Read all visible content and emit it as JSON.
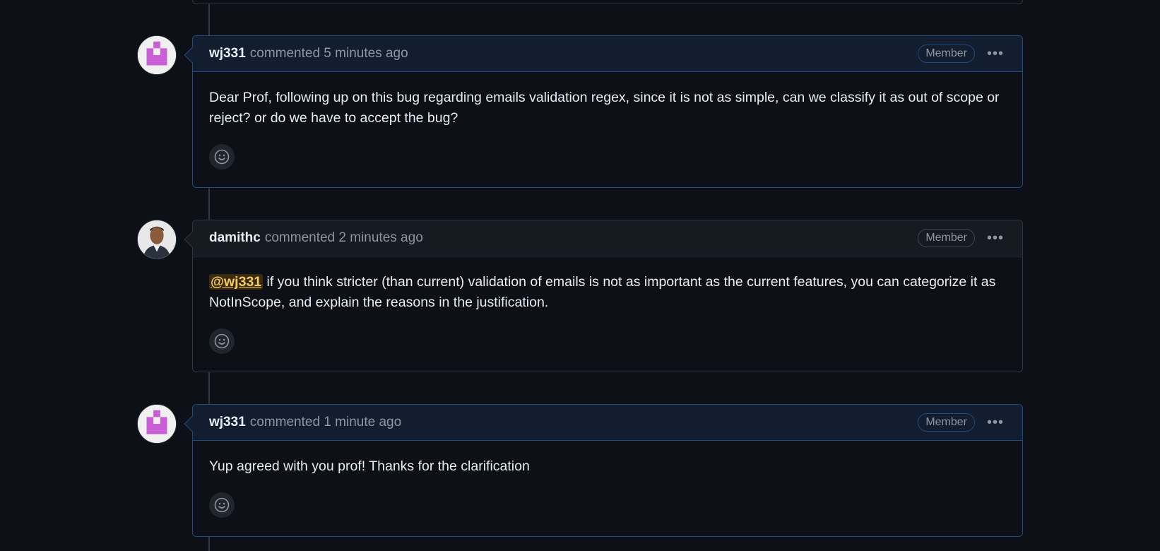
{
  "comments": [
    {
      "author": "wj331",
      "meta": "commented 5 minutes ago",
      "badge": "Member",
      "body": "Dear Prof, following up on this bug regarding emails validation regex, since it is not as simple, can we classify it as out of scope or reject? or do we have to accept the bug?"
    },
    {
      "author": "damithc",
      "meta": "commented 2 minutes ago",
      "badge": "Member",
      "mention": "@wj331",
      "body": " if you think stricter (than current) validation of emails is not as important as the current features, you can categorize it as NotInScope, and explain the reasons in the justification."
    },
    {
      "author": "wj331",
      "meta": "commented 1 minute ago",
      "badge": "Member",
      "body": "Yup agreed with you prof! Thanks for the clarification"
    }
  ],
  "icons": {
    "kebab": "kebab-horizontal-icon",
    "reaction": "smiley-icon"
  },
  "colors": {
    "background": "#0d1117",
    "identicon": "#c95ed6",
    "mention_bg": "#3b2a0e",
    "mention_fg": "#f2cc60"
  }
}
